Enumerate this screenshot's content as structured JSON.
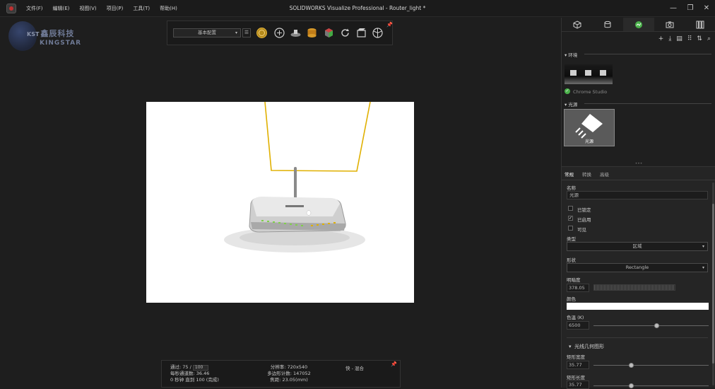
{
  "titlebar": {
    "title": "SOLIDWORKS Visualize Professional - Router_light *",
    "menu": [
      "文件(F)",
      "编辑(E)",
      "视图(V)",
      "项目(P)",
      "工具(T)",
      "帮助(H)"
    ],
    "minimize": "—",
    "restore": "❐",
    "close": "✕"
  },
  "logo": {
    "kst": "KST",
    "cn": "鑫辰科技",
    "en": "KINGSTAR"
  },
  "toolbar": {
    "preset": "基本配置",
    "dropdown_arrow": "▾",
    "list_icon": "☰",
    "pin": "📌",
    "icons": [
      "render-sphere-icon",
      "brain-icon",
      "floor-tool-icon",
      "database-tool-icon",
      "cube-tool-icon",
      "refresh-icon",
      "camera-clip-icon",
      "aperture-icon"
    ]
  },
  "hud": {
    "passes_label": "通过: 75 /",
    "passes_total": "100",
    "fps": "每秒通道数: 36.46",
    "time": "0 秒钟 直到 100 (完成)",
    "resolution": "分辨率: 720x540",
    "polycount": "多边形计数: 147052",
    "focal": "焦距: 23.05(mm)",
    "mode": "快 - 混合",
    "pin": "📌"
  },
  "panel": {
    "tabs": [
      "model-tab-icon",
      "material-tab-icon",
      "scene-tab-icon",
      "camera-tab-icon",
      "library-tab-icon"
    ],
    "tools": [
      "+",
      "⤓",
      "▤",
      "⠿",
      "⇅",
      "⌕"
    ],
    "environment_header": "▾ 环境",
    "environment_name": "Chrome Studio",
    "lights_header": "▾ 光源",
    "light_thumb_label": "光源",
    "splitter": "•••"
  },
  "props": {
    "subtabs": [
      "常规",
      "转换",
      "高级"
    ],
    "name_label": "名称",
    "name_value": "光源",
    "check_locked": "已锁定",
    "check_enabled": "已启用",
    "check_visible": "可见",
    "type_label": "类型",
    "type_value": "区域",
    "shape_label": "形状",
    "shape_value": "Rectangle",
    "brightness_label": "明暗度",
    "brightness_value": "378.05",
    "color_label": "颜色",
    "color_value": "#ffffff",
    "colortemp_label": "色温 (K)",
    "colortemp_value": "6500",
    "colortemp_level": 0.55,
    "geom_header": "光线几何图形",
    "rect_width_label": "矩形宽度",
    "rect_width_value": "35.77",
    "rect_width_level": 0.33,
    "rect_length_label": "矩形长度",
    "rect_length_value": "35.77"
  },
  "colors": {
    "accent_green": "#4bb24b",
    "selection_yellow": "#e0b000"
  }
}
